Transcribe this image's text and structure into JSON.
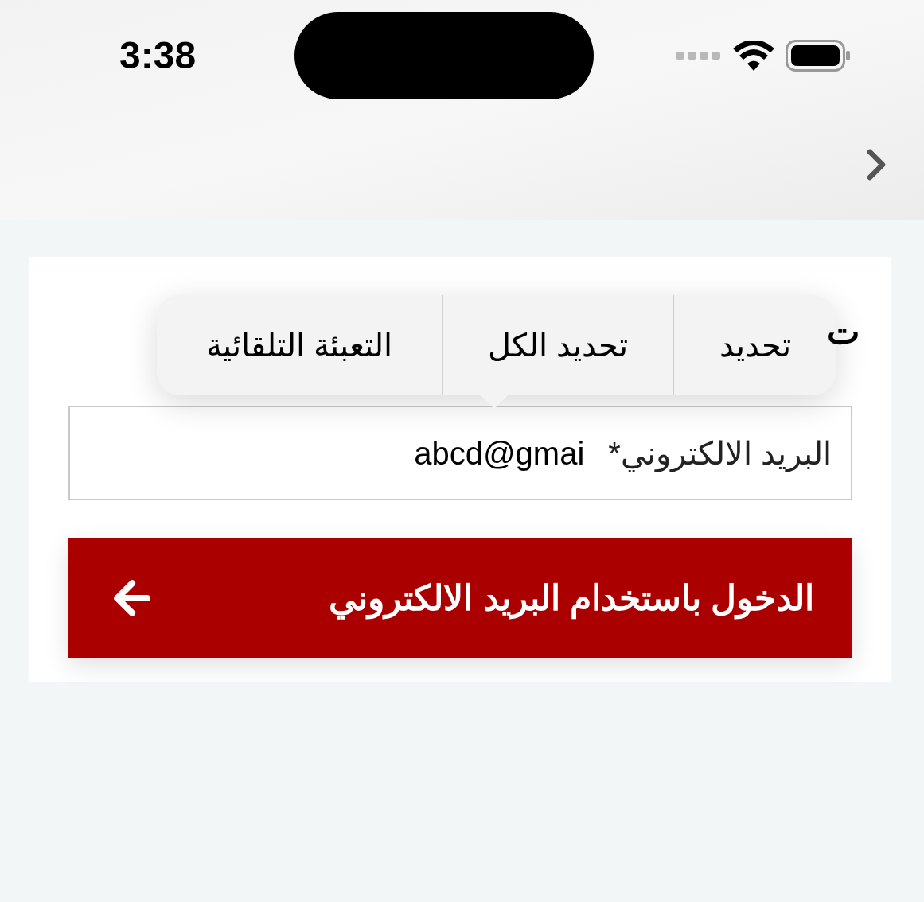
{
  "status_bar": {
    "time": "3:38"
  },
  "heading": {
    "text": "ت"
  },
  "context_menu": {
    "items": [
      {
        "label": "تحديد"
      },
      {
        "label": "تحديد الكل"
      },
      {
        "label": "التعبئة التلقائية"
      }
    ]
  },
  "email_field": {
    "label": "البريد الالكتروني*",
    "value": "abcd@gmai"
  },
  "login_button": {
    "label": "الدخول باستخدام البريد الالكتروني"
  }
}
